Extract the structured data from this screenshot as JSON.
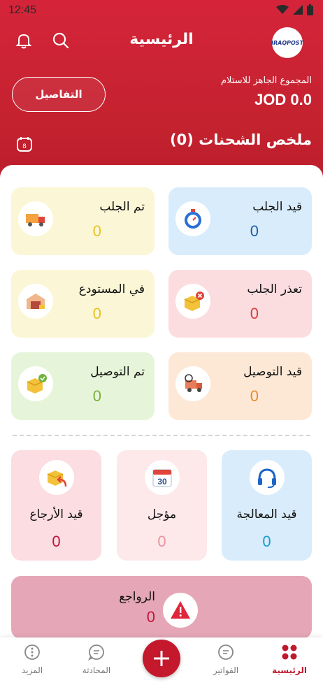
{
  "status_bar": {
    "time": "12:45"
  },
  "header": {
    "title": "الرئيسية",
    "logo_text": "IRAQPOST",
    "ready_label": "المجموع الجاهز للاستلام",
    "amount": "JOD 0.0",
    "details_button": "التفاصيل",
    "summary_title": "ملخص الشحنات (0)",
    "calendar_badge": "8"
  },
  "colors": {
    "brand": "#c4222f",
    "blue": "#1b5fa8",
    "yellow": "#e6c32a",
    "red": "#d83a3a",
    "green": "#7cae3a",
    "orange": "#e88a2a",
    "pink": "#c2143a"
  },
  "status_cards": [
    {
      "name": "قيد الجلب",
      "count": "0",
      "icon": "stopwatch-icon"
    },
    {
      "name": "تم الجلب",
      "count": "0",
      "icon": "truck-icon"
    },
    {
      "name": "تعذر الجلب",
      "count": "0",
      "icon": "box-cancel-icon"
    },
    {
      "name": "في المستودع",
      "count": "0",
      "icon": "warehouse-icon"
    },
    {
      "name": "قيد التوصيل",
      "count": "0",
      "icon": "delivery-van-icon"
    },
    {
      "name": "تم التوصيل",
      "count": "0",
      "icon": "box-check-icon"
    }
  ],
  "tiles": [
    {
      "name": "قيد المعالجة",
      "count": "0",
      "icon": "headset-icon"
    },
    {
      "name": "مؤجل",
      "count": "0",
      "icon": "calendar-30-icon",
      "icon_text": "30"
    },
    {
      "name": "قيد الأرجاع",
      "count": "0",
      "icon": "box-return-icon"
    }
  ],
  "returns": {
    "name": "الرواجع",
    "count": "0",
    "icon": "warning-icon"
  },
  "bottom_nav": [
    {
      "label": "الرئيسية",
      "icon": "grid-icon",
      "active": true
    },
    {
      "label": "الفواتير",
      "icon": "invoice-icon"
    },
    {
      "label": "المحادثة",
      "icon": "chat-icon"
    },
    {
      "label": "المزيد",
      "icon": "more-icon"
    }
  ]
}
